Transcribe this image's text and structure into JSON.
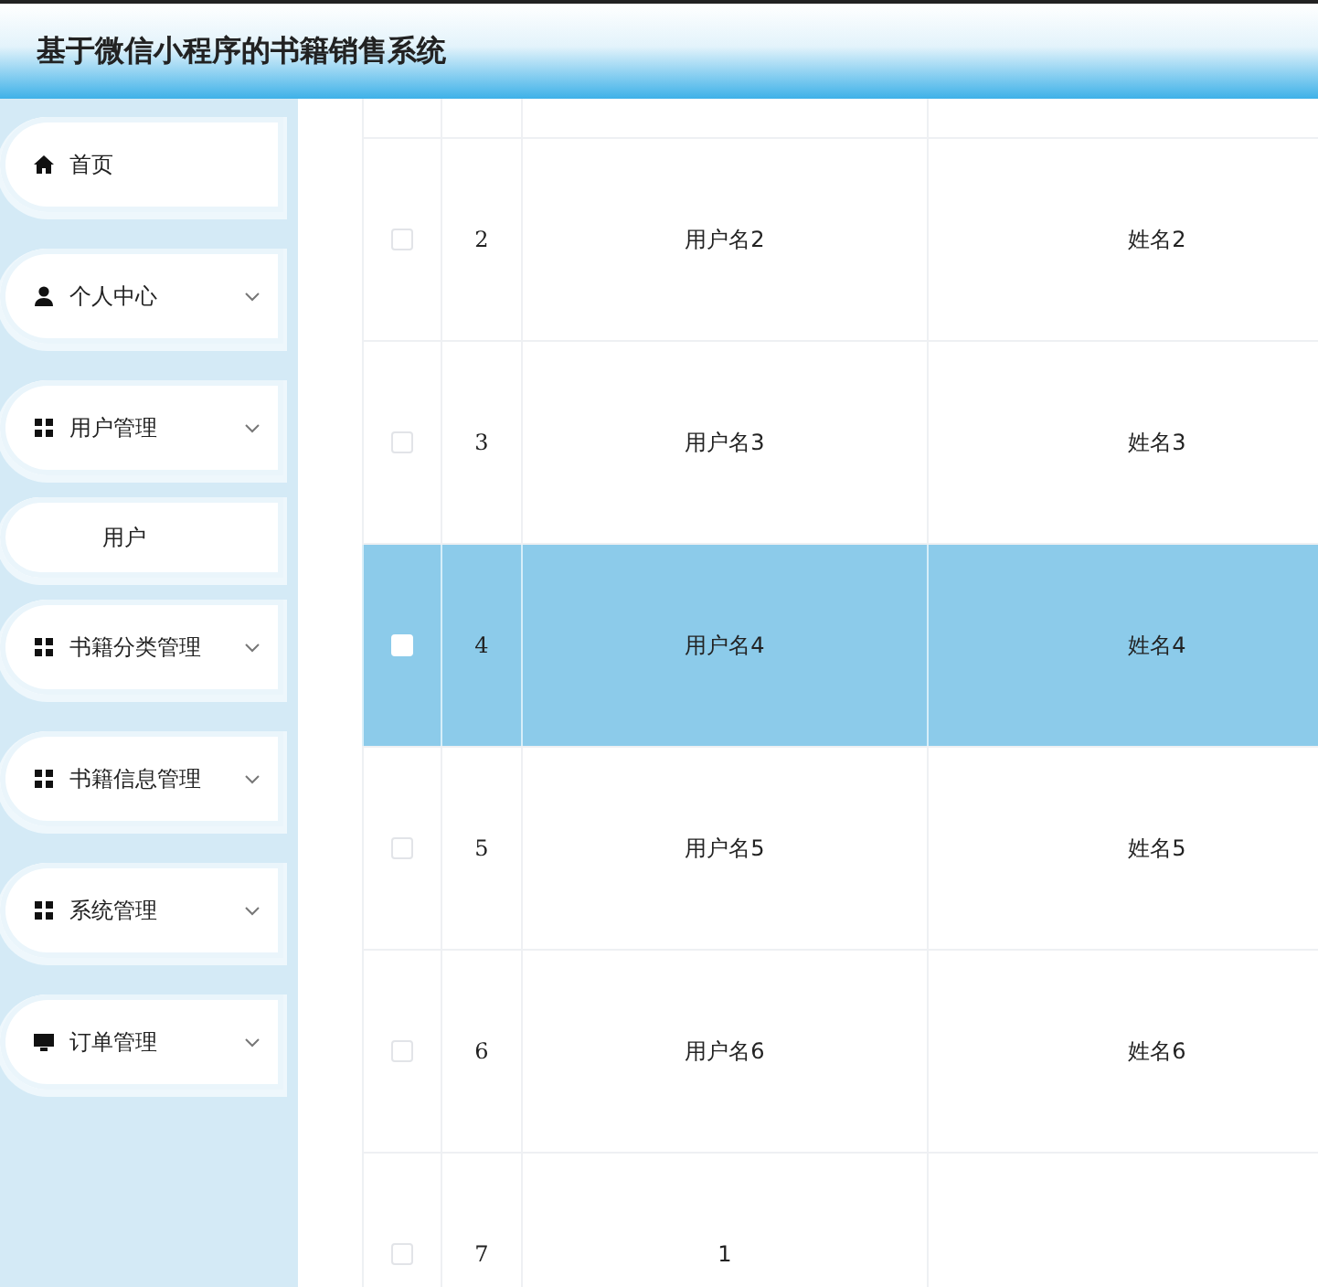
{
  "header": {
    "title": "基于微信小程序的书籍销售系统"
  },
  "menu": [
    {
      "kind": "home",
      "label": "首页",
      "expandable": false
    },
    {
      "kind": "user",
      "label": "个人中心",
      "expandable": true
    },
    {
      "kind": "grid",
      "label": "用户管理",
      "expandable": true
    },
    {
      "kind": "sub",
      "label": "用户"
    },
    {
      "kind": "grid",
      "label": "书籍分类管理",
      "expandable": true
    },
    {
      "kind": "grid",
      "label": "书籍信息管理",
      "expandable": true
    },
    {
      "kind": "grid",
      "label": "系统管理",
      "expandable": true
    },
    {
      "kind": "monitor",
      "label": "订单管理",
      "expandable": true
    }
  ],
  "table": {
    "rows": [
      {
        "index": "2",
        "username": "用户名2",
        "name": "姓名2",
        "selected": false
      },
      {
        "index": "3",
        "username": "用户名3",
        "name": "姓名3",
        "selected": false
      },
      {
        "index": "4",
        "username": "用户名4",
        "name": "姓名4",
        "selected": true
      },
      {
        "index": "5",
        "username": "用户名5",
        "name": "姓名5",
        "selected": false
      },
      {
        "index": "6",
        "username": "用户名6",
        "name": "姓名6",
        "selected": false
      },
      {
        "index": "7",
        "username": "1",
        "selected": false
      }
    ]
  }
}
